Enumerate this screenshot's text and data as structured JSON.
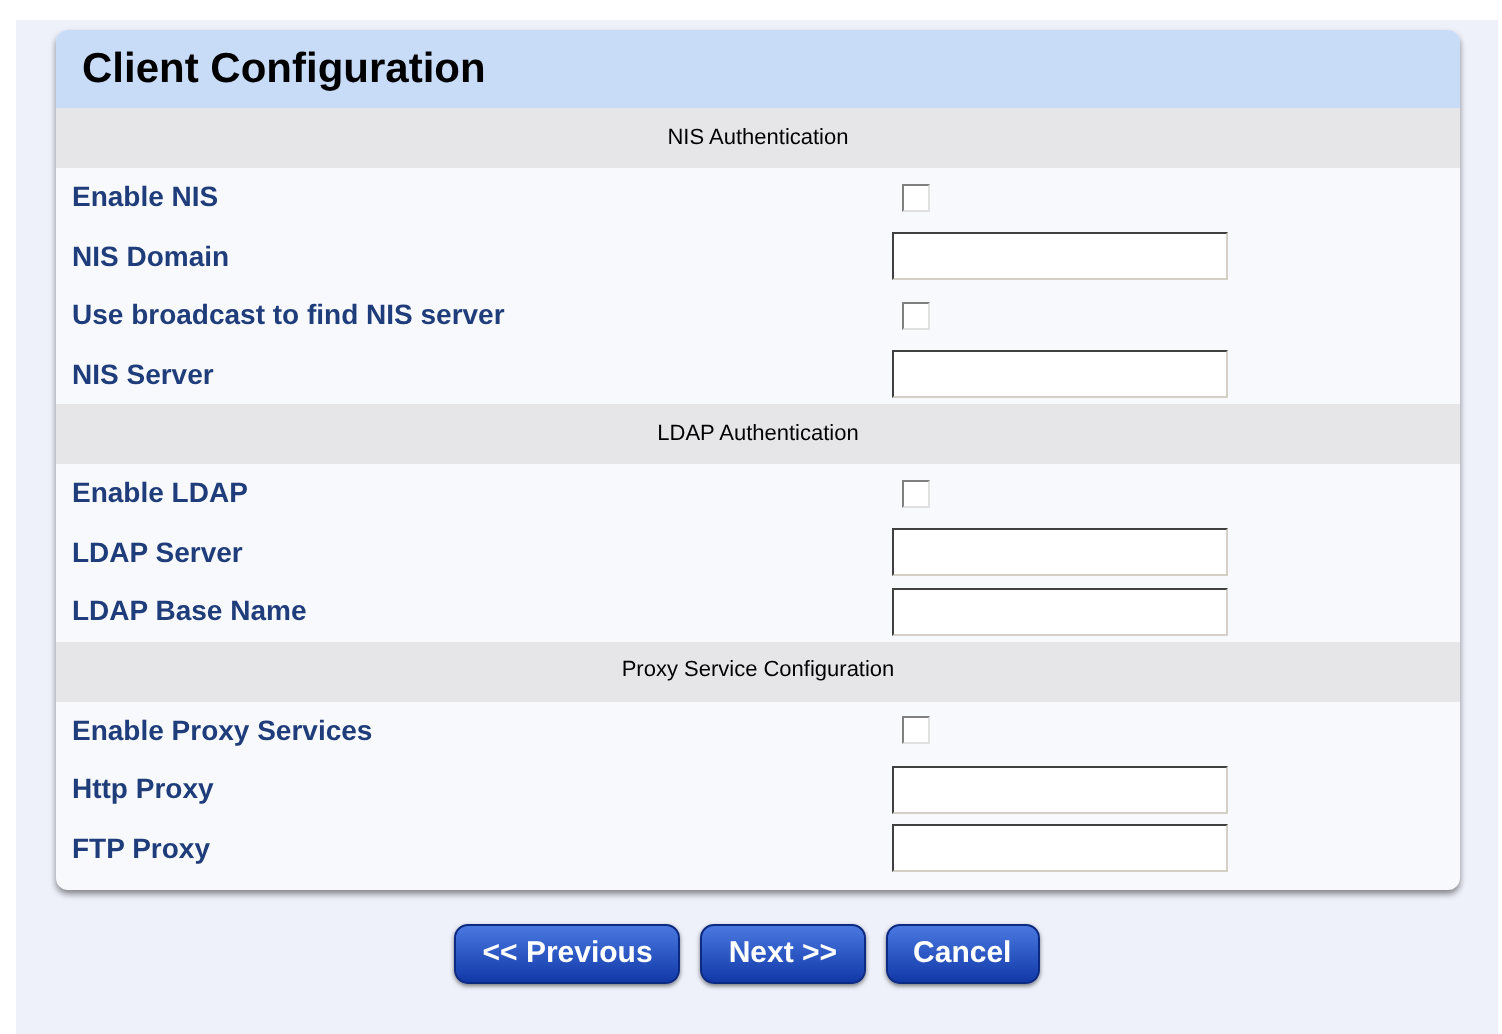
{
  "title": "Client Configuration",
  "sections": [
    {
      "heading": "NIS Authentication",
      "rows": [
        {
          "label": "Enable NIS",
          "kind": "checkbox",
          "checked": false
        },
        {
          "label": "NIS Domain",
          "kind": "text"
        },
        {
          "label": "Use broadcast to find NIS server",
          "kind": "checkbox",
          "checked": false
        },
        {
          "label": "NIS Server",
          "kind": "text"
        }
      ]
    },
    {
      "heading": "LDAP Authentication",
      "rows": [
        {
          "label": "Enable LDAP",
          "kind": "checkbox",
          "checked": false
        },
        {
          "label": "LDAP Server",
          "kind": "text"
        },
        {
          "label": "LDAP Base Name",
          "kind": "text"
        }
      ]
    },
    {
      "heading": "Proxy Service Configuration",
      "rows": [
        {
          "label": "Enable Proxy Services",
          "kind": "checkbox",
          "checked": false
        },
        {
          "label": "Http Proxy",
          "kind": "text"
        },
        {
          "label": "FTP Proxy",
          "kind": "text"
        }
      ]
    }
  ],
  "buttons": [
    "<< Previous",
    "Next >>",
    "Cancel"
  ]
}
